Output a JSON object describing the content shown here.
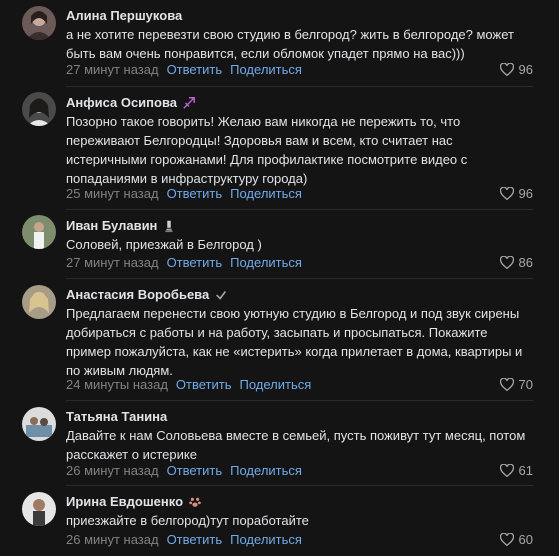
{
  "comments": [
    {
      "author": "Алина Першукова",
      "badge": "",
      "text": "а не хотите перевезти свою студию в белгород? жить в белгороде? может быть вам очень понравится, если обломок упадет прямо на вас)))",
      "time": "27 минут назад",
      "reply": "Ответить",
      "share": "Поделиться",
      "likes": "96"
    },
    {
      "author": "Анфиса Осипова",
      "badge": "sagittarius-icon",
      "text": "Позорно такое говорить! Желаю вам никогда не пережить то, что переживают Белгородцы! Здоровья вам и всем, кто считает нас истеричными горожанами! Для профилактике посмотрите видео с попаданиями в инфраструктуру города)",
      "time": "25 минут назад",
      "reply": "Ответить",
      "share": "Поделиться",
      "likes": "96"
    },
    {
      "author": "Иван Булавин",
      "badge": "trophy-icon",
      "text": "Соловей, приезжай в Белгород )",
      "time": "27 минут назад",
      "reply": "Ответить",
      "share": "Поделиться",
      "likes": "86"
    },
    {
      "author": "Анастасия Воробьева",
      "badge": "verified-check-icon",
      "text": "Предлагаем перенести свою уютную студию в Белгород и под звук сирены добираться с работы и на работу, засыпать и просыпаться. Покажите пример пожалуйста, как не «истерить» когда прилетает в дома, квартиры и по живым людям.",
      "time": "24 минуты назад",
      "reply": "Ответить",
      "share": "Поделиться",
      "likes": "70"
    },
    {
      "author": "Татьяна Танина",
      "badge": "",
      "text": "Давайте к нам Соловьева вместе в семьей, пусть поживут тут месяц, потом расскажет о истерике",
      "time": "26 минут назад",
      "reply": "Ответить",
      "share": "Поделиться",
      "likes": "61"
    },
    {
      "author": "Ирина Евдошенко",
      "badge": "paw-icon",
      "text": "приезжайте в белгород)тут поработайте",
      "time": "26 минут назад",
      "reply": "Ответить",
      "share": "Поделиться",
      "likes": "60"
    }
  ],
  "colors": {
    "background": "#141414",
    "text": "#e1e3e6",
    "meta": "#828282",
    "link": "#71aaeb"
  }
}
